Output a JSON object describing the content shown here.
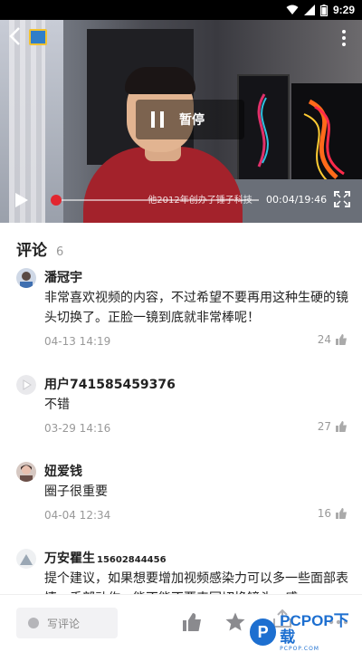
{
  "status_bar": {
    "time": "9:29"
  },
  "video": {
    "pause_label": "暂停",
    "subtitle": "他2012年创办了锤子科技",
    "time": "00:04/19:46",
    "progress_fraction": 0.017
  },
  "comments": {
    "title": "评论",
    "count": "6",
    "items": [
      {
        "name": "潘冠宇",
        "name_extra": "",
        "text": "非常喜欢视频的内容，不过希望不要再用这种生硬的镜头切换了。正脸一镜到底就非常棒呢！",
        "time": "04-13 14:19",
        "likes": "24"
      },
      {
        "name": "用户741585459376",
        "name_extra": "",
        "text": "不错",
        "time": "03-29 14:16",
        "likes": "27"
      },
      {
        "name": "妞爱钱",
        "name_extra": "",
        "text": "圈子很重要",
        "time": "04-04 12:34",
        "likes": "16"
      },
      {
        "name": "万安瞿生",
        "name_extra": "15602844456",
        "text": "提个建议，如果想要增加视频感染力可以多一些面部表情、手部动作，能不能不要来回切换镜头，感",
        "time": "",
        "likes": ""
      }
    ]
  },
  "bottom_bar": {
    "write_comment_placeholder": "写评论"
  },
  "watermark": {
    "main": "PCPOP下载",
    "sub": "PCPOP.COM"
  }
}
